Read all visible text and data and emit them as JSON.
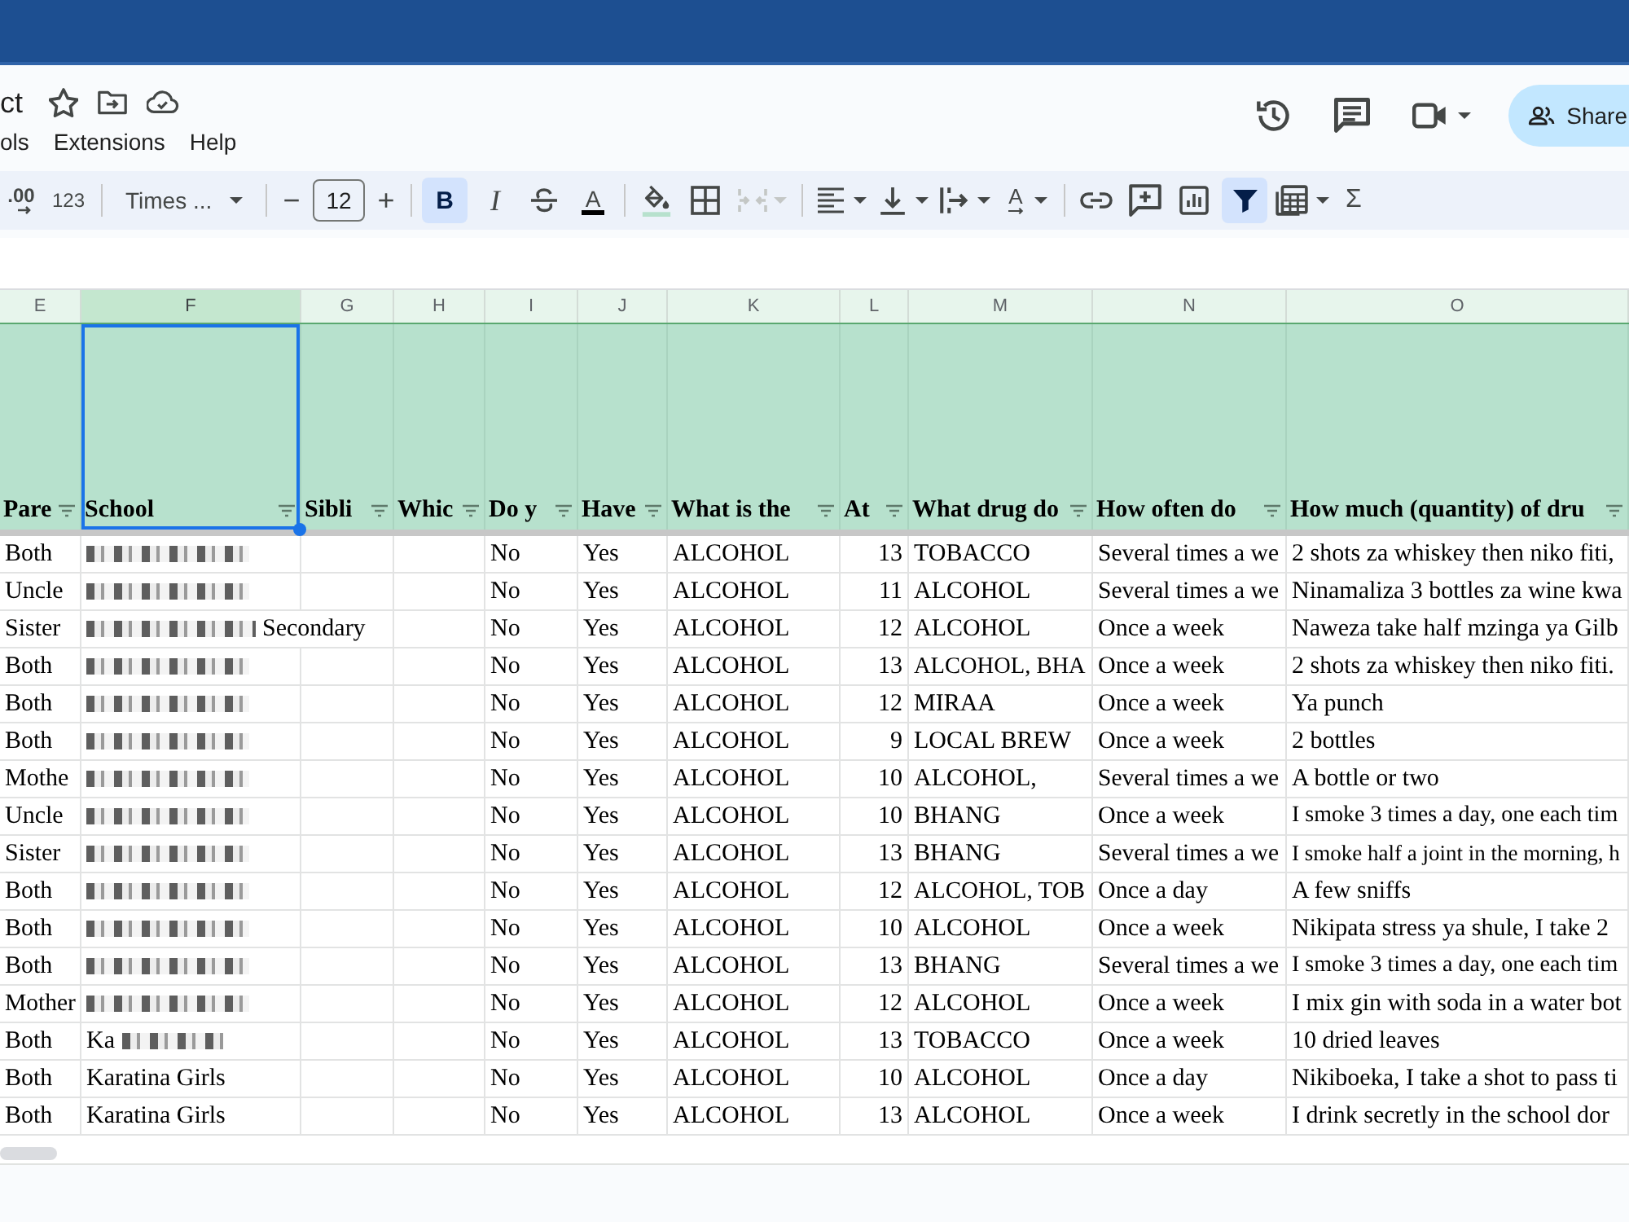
{
  "document": {
    "title": "ct"
  },
  "menu": [
    "ols",
    "Extensions",
    "Help"
  ],
  "share": {
    "label": "Share"
  },
  "toolbar": {
    "decimal_label": ".00",
    "format_label": "123",
    "font": "Times ...",
    "minus": "−",
    "font_size": "12",
    "plus": "+",
    "bold": {
      "label": "B",
      "selected": true
    },
    "italic": {
      "label": "I",
      "selected": false
    },
    "strikethrough": {
      "selected": false
    },
    "text_color": {
      "label": "A"
    },
    "merge": {
      "disabled": true
    },
    "rotation": {
      "label": "A"
    },
    "filter": {
      "selected": true
    },
    "functions": "Σ"
  },
  "columns": [
    {
      "letter": "E",
      "header": "Pare",
      "selected": false
    },
    {
      "letter": "F",
      "header": "School",
      "selected": true
    },
    {
      "letter": "G",
      "header": "Sibli",
      "selected": false
    },
    {
      "letter": "H",
      "header": "Whic",
      "selected": false
    },
    {
      "letter": "I",
      "header": "Do y",
      "selected": false
    },
    {
      "letter": "J",
      "header": "Have",
      "selected": false
    },
    {
      "letter": "K",
      "header": "What is the",
      "selected": false
    },
    {
      "letter": "L",
      "header": "At",
      "selected": false
    },
    {
      "letter": "M",
      "header": "What drug do",
      "selected": false
    },
    {
      "letter": "N",
      "header": "How often do",
      "selected": false
    },
    {
      "letter": "O",
      "header": "How much (quantity) of dru",
      "selected": false
    }
  ],
  "rows": [
    {
      "column_e": "Both",
      "school": [
        {
          "redacted": true
        }
      ],
      "column_i": "No",
      "column_j": "Yes",
      "column_k": "ALCOHOL",
      "column_l": "13",
      "column_m": "TOBACCO",
      "column_n": "Several times a we",
      "column_o": "2 shots za whiskey then niko fiti,"
    },
    {
      "column_e": "Uncle",
      "school": [
        {
          "redacted": true
        }
      ],
      "column_i": "No",
      "column_j": "Yes",
      "column_k": "ALCOHOL",
      "column_l": "11",
      "column_m": "ALCOHOL",
      "column_n": "Several times a we",
      "column_o": "Ninamaliza 3 bottles za wine kwa"
    },
    {
      "column_e": "Sister",
      "school": [
        {
          "redacted": true
        },
        {
          "text": "Secondary",
          "redacted": false
        }
      ],
      "column_i": "No",
      "column_j": "Yes",
      "column_k": "ALCOHOL",
      "column_l": "12",
      "column_m": "ALCOHOL",
      "column_n": "Once a week",
      "column_o": "Naweza take half mzinga ya Gilb"
    },
    {
      "column_e": "Both",
      "school": [
        {
          "redacted": true
        }
      ],
      "column_i": "No",
      "column_j": "Yes",
      "column_k": "ALCOHOL",
      "column_l": "13",
      "column_m": "ALCOHOL, BHA",
      "column_n": "Once a week",
      "column_o": "2 shots za whiskey then niko fiti."
    },
    {
      "column_e": "Both",
      "school": [
        {
          "redacted": true
        }
      ],
      "column_i": "No",
      "column_j": "Yes",
      "column_k": "ALCOHOL",
      "column_l": "12",
      "column_m": "MIRAA",
      "column_n": "Once a week",
      "column_o": "Ya punch"
    },
    {
      "column_e": "Both",
      "school": [
        {
          "redacted": true
        }
      ],
      "column_i": "No",
      "column_j": "Yes",
      "column_k": "ALCOHOL",
      "column_l": "9",
      "column_m": "LOCAL BREW",
      "column_n": "Once a week",
      "column_o": "2 bottles"
    },
    {
      "column_e": "Mothe",
      "school": [
        {
          "redacted": true
        }
      ],
      "column_i": "No",
      "column_j": "Yes",
      "column_k": "ALCOHOL",
      "column_l": "10",
      "column_m": "ALCOHOL,",
      "column_n": "Several times a we",
      "column_o": "A bottle or two"
    },
    {
      "column_e": "Uncle",
      "school": [
        {
          "redacted": true
        }
      ],
      "column_i": "No",
      "column_j": "Yes",
      "column_k": "ALCOHOL",
      "column_l": "10",
      "column_m": "BHANG",
      "column_n": "Once a week",
      "column_o": "I smoke 3 times a day, one each tim"
    },
    {
      "column_e": "Sister",
      "school": [
        {
          "redacted": true
        }
      ],
      "column_i": "No",
      "column_j": "Yes",
      "column_k": "ALCOHOL",
      "column_l": "13",
      "column_m": "BHANG",
      "column_n": "Several times a we",
      "column_o": "I smoke half a joint in the morning, h"
    },
    {
      "column_e": "Both",
      "school": [
        {
          "redacted": true
        }
      ],
      "column_i": "No",
      "column_j": "Yes",
      "column_k": "ALCOHOL",
      "column_l": "12",
      "column_m": "ALCOHOL, TOB",
      "column_n": "Once a day",
      "column_o": "A few sniffs"
    },
    {
      "column_e": "Both",
      "school": [
        {
          "redacted": true
        }
      ],
      "column_i": "No",
      "column_j": "Yes",
      "column_k": "ALCOHOL",
      "column_l": "10",
      "column_m": "ALCOHOL",
      "column_n": "Once a week",
      "column_o": "Nikipata stress ya shule, I take 2"
    },
    {
      "column_e": "Both",
      "school": [
        {
          "redacted": true
        }
      ],
      "column_i": "No",
      "column_j": "Yes",
      "column_k": "ALCOHOL",
      "column_l": "13",
      "column_m": "BHANG",
      "column_n": "Several times a we",
      "column_o": "I smoke 3 times a day, one each tim"
    },
    {
      "column_e": "Mother",
      "school": [
        {
          "redacted": true
        }
      ],
      "column_i": "No",
      "column_j": "Yes",
      "column_k": "ALCOHOL",
      "column_l": "12",
      "column_m": "ALCOHOL",
      "column_n": "Once a week",
      "column_o": "I mix gin with soda in a water bot"
    },
    {
      "column_e": "Both",
      "school": [
        {
          "text": "Ka",
          "redacted": false
        },
        {
          "redacted": true
        }
      ],
      "column_i": "No",
      "column_j": "Yes",
      "column_k": "ALCOHOL",
      "column_l": "13",
      "column_m": "TOBACCO",
      "column_n": "Once a week",
      "column_o": "10 dried leaves"
    },
    {
      "column_e": "Both",
      "school": [
        {
          "text": "Karatina Girls",
          "redacted": false
        }
      ],
      "column_i": "No",
      "column_j": "Yes",
      "column_k": "ALCOHOL",
      "column_l": "10",
      "column_m": "ALCOHOL",
      "column_n": "Once a day",
      "column_o": "Nikiboeka, I take a shot to pass ti"
    },
    {
      "column_e": "Both",
      "school": [
        {
          "text": "Karatina Girls",
          "redacted": false
        }
      ],
      "column_i": "No",
      "column_j": "Yes",
      "column_k": "ALCOHOL",
      "column_l": "13",
      "column_m": "ALCOHOL",
      "column_n": "Once a week",
      "column_o": "I drink secretly in the school dor"
    }
  ]
}
